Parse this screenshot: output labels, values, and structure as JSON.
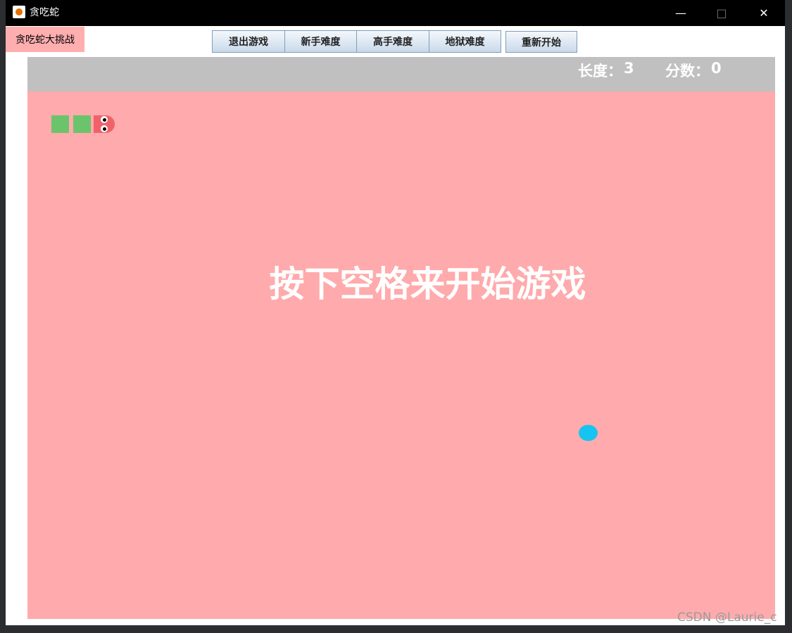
{
  "window": {
    "title": "贪吃蛇",
    "icon": "java-app-icon"
  },
  "title_tag": "贪吃蛇大挑战",
  "toolbar": {
    "buttons": [
      {
        "label": "退出游戏"
      },
      {
        "label": "新手难度"
      },
      {
        "label": "高手难度"
      },
      {
        "label": "地狱难度"
      }
    ],
    "restart_label": "重新开始"
  },
  "scorebar": {
    "length_label": "长度：",
    "length_value": "3",
    "score_label": "分数：",
    "score_value": "0"
  },
  "board": {
    "message": "按下空格来开始游戏",
    "snake_length": 3,
    "food_color": "#16c4f2"
  },
  "colors": {
    "board": "#ffaaac",
    "scorebar": "#c0c0c0",
    "snake_body": "#6bc46c",
    "snake_head": "#f0626a",
    "title_tag": "#ffaeb0"
  },
  "watermark": "CSDN @Laurie_c"
}
